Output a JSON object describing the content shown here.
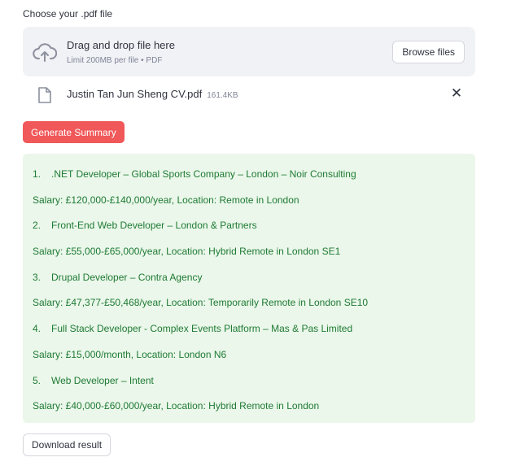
{
  "uploader": {
    "label": "Choose your .pdf file",
    "drop_title": "Drag and drop file here",
    "drop_limit": "Limit 200MB per file • PDF",
    "browse_label": "Browse files",
    "cloud_icon": "cloud-upload-icon"
  },
  "uploaded_file": {
    "name": "Justin Tan Jun Sheng CV.pdf",
    "size": "161.4KB",
    "file_icon": "file-icon",
    "remove_glyph": "✕"
  },
  "generate_label": "Generate Summary",
  "results": [
    {
      "kind": "item",
      "num": "1.",
      "text": ".NET Developer – Global Sports Company – London – Noir Consulting"
    },
    {
      "kind": "salary",
      "text": "Salary: £120,000-£140,000/year, Location: Remote in London"
    },
    {
      "kind": "item",
      "num": "2.",
      "text": "Front-End Web Developer – London & Partners"
    },
    {
      "kind": "salary",
      "text": "Salary: £55,000-£65,000/year, Location: Hybrid Remote in London SE1"
    },
    {
      "kind": "item",
      "num": "3.",
      "text": "Drupal Developer – Contra Agency"
    },
    {
      "kind": "salary",
      "text": "Salary: £47,377-£50,468/year, Location: Temporarily Remote in London SE10"
    },
    {
      "kind": "item",
      "num": "4.",
      "text": "Full Stack Developer - Complex Events Platform – Mas & Pas Limited"
    },
    {
      "kind": "salary",
      "text": "Salary: £15,000/month, Location: London N6"
    },
    {
      "kind": "item",
      "num": "5.",
      "text": "Web Developer – Intent"
    },
    {
      "kind": "salary",
      "text": "Salary: £40,000-£60,000/year, Location: Hybrid Remote in London"
    }
  ],
  "download_label": "Download result",
  "colors": {
    "primary_button": "#f0585a",
    "result_background": "#eaf7ea",
    "result_text": "#1f7a34",
    "dropzone_background": "#f0f2f6"
  }
}
